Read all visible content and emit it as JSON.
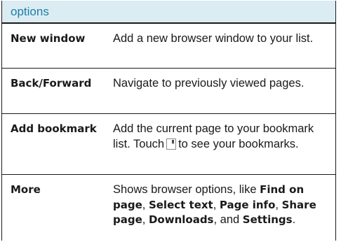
{
  "table": {
    "header": "options",
    "rows": [
      {
        "term": "New window",
        "desc": "Add a new browser window to your list."
      },
      {
        "term": "Back/Forward",
        "desc": "Navigate to previously viewed pages."
      },
      {
        "term": "Add bookmark",
        "desc_before": "Add the current page to your bookmark list. Touch",
        "icon": "bookmark-icon",
        "desc_after": "to see your bookmarks."
      },
      {
        "term": "More",
        "desc_parts": [
          "Shows browser options, like ",
          "Find on page",
          ", ",
          "Select text",
          ", ",
          "Page info",
          ", ",
          "Share page",
          ", ",
          "Downloads",
          ", and ",
          "Settings",
          "."
        ]
      }
    ]
  }
}
